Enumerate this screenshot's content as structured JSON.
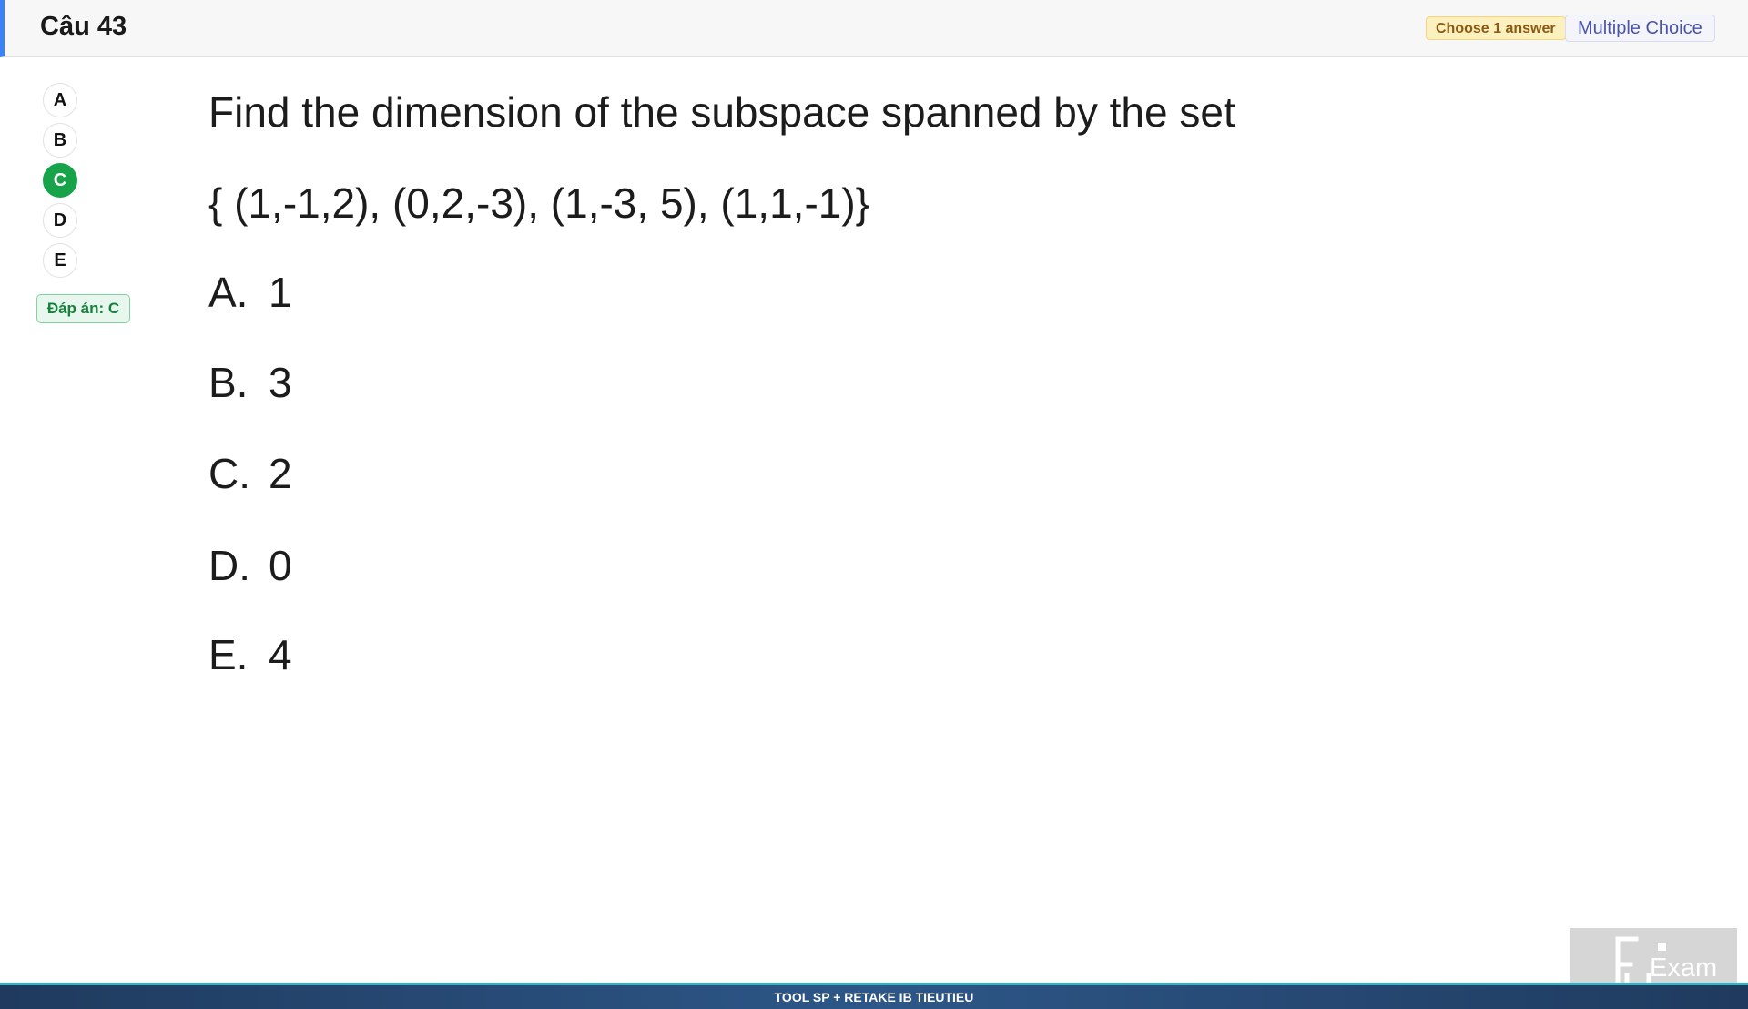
{
  "header": {
    "title": "Câu 43",
    "choose_badge": "Choose 1 answer",
    "type_badge": "Multiple Choice"
  },
  "selector": {
    "options": [
      "A",
      "B",
      "C",
      "D",
      "E"
    ],
    "selected": "C",
    "answer_badge": "Đáp án: C"
  },
  "question": {
    "text": "Find the dimension of the subspace spanned by the set",
    "set": "{ (1,-1,2), (0,2,-3), (1,-3, 5), (1,1,-1)}",
    "choices": [
      {
        "letter": "A.",
        "value": "1"
      },
      {
        "letter": "B.",
        "value": "3"
      },
      {
        "letter": "C.",
        "value": "2"
      },
      {
        "letter": "D.",
        "value": "0"
      },
      {
        "letter": "E.",
        "value": "4"
      }
    ]
  },
  "footer": {
    "text": "TOOL SP + RETAKE IB TIEUTIEU"
  },
  "logo": {
    "name": "fu-exam-logo",
    "text": "Exam"
  },
  "colors": {
    "accent": "#3b82f6",
    "selected": "#16a34a",
    "footer": "#2d5788"
  }
}
